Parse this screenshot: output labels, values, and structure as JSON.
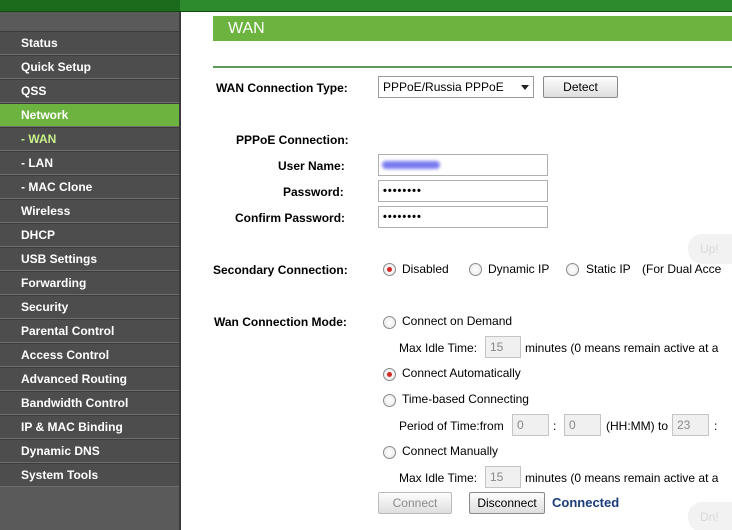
{
  "sidebar": {
    "items": [
      {
        "label": "Status"
      },
      {
        "label": "Quick Setup"
      },
      {
        "label": "QSS"
      },
      {
        "label": "Network"
      },
      {
        "label": "- WAN"
      },
      {
        "label": "- LAN"
      },
      {
        "label": "- MAC Clone"
      },
      {
        "label": "Wireless"
      },
      {
        "label": "DHCP"
      },
      {
        "label": "USB Settings"
      },
      {
        "label": "Forwarding"
      },
      {
        "label": "Security"
      },
      {
        "label": "Parental Control"
      },
      {
        "label": "Access Control"
      },
      {
        "label": "Advanced Routing"
      },
      {
        "label": "Bandwidth Control"
      },
      {
        "label": "IP & MAC Binding"
      },
      {
        "label": "Dynamic DNS"
      },
      {
        "label": "System Tools"
      }
    ]
  },
  "header": {
    "title": "WAN"
  },
  "form": {
    "wan_type_label": "WAN Connection Type:",
    "wan_type_value": "PPPoE/Russia PPPoE",
    "detect_label": "Detect",
    "pppoe_section": "PPPoE Connection:",
    "username_label": "User Name:",
    "password_label": "Password:",
    "password_value": "••••••••",
    "confirm_label": "Confirm Password:",
    "confirm_value": "••••••••",
    "secondary_label": "Secondary Connection:",
    "secondary_options": [
      "Disabled",
      "Dynamic IP",
      "Static IP",
      "(For Dual Acce"
    ],
    "mode_label": "Wan Connection Mode:",
    "opt_demand": "Connect on Demand",
    "max_idle": "Max Idle Time:",
    "idle_value_1": "15",
    "idle_hint": "minutes (0 means remain active at a",
    "opt_auto": "Connect Automatically",
    "opt_time": "Time-based Connecting",
    "period_label": "Period of Time:from",
    "from_h": "0",
    "colon": ":",
    "from_m": "0",
    "hhmm_to": "(HH:MM) to",
    "to_h": "23",
    "colon2": ":",
    "opt_manual": "Connect Manually",
    "max_idle_2": "Max Idle Time:",
    "idle_value_2": "15",
    "idle_hint_2": "minutes (0 means remain active at a",
    "connect_label": "Connect",
    "disconnect_label": "Disconnect",
    "status": "Connected"
  },
  "ghost": {
    "top": "Up!",
    "bottom": "Dn!"
  },
  "colors": {
    "accent": "#6db33f",
    "sidebar": "#4d4d4d",
    "status": "#1a3c7a"
  }
}
